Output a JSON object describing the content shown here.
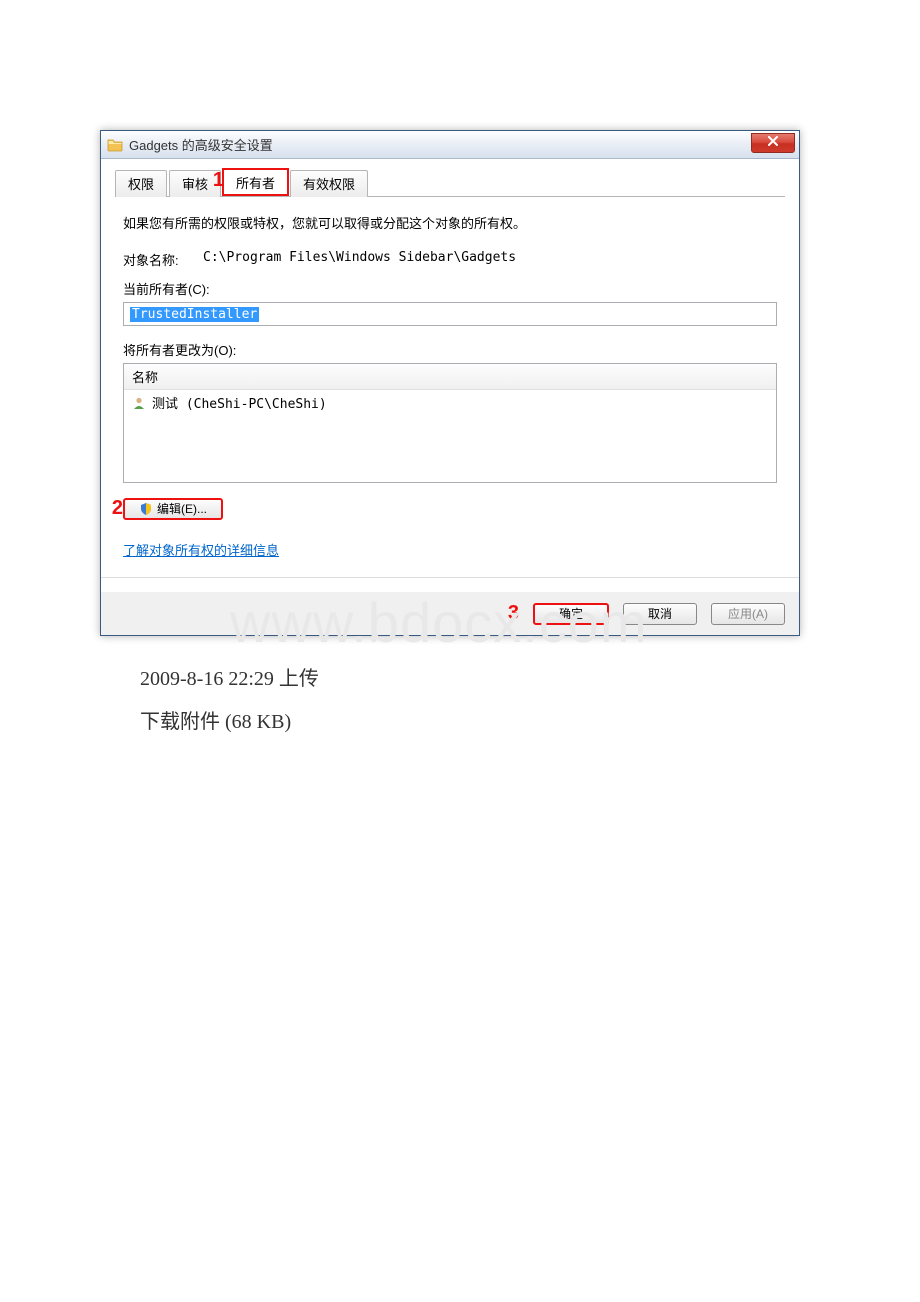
{
  "dialog": {
    "title": "Gadgets 的高级安全设置",
    "close_icon": "×"
  },
  "tabs": {
    "permissions": "权限",
    "auditing": "审核",
    "owner": "所有者",
    "effective": "有效权限"
  },
  "annotations": {
    "one": "1",
    "two": "2",
    "three": "3"
  },
  "content": {
    "intro": "如果您有所需的权限或特权，您就可以取得或分配这个对象的所有权。",
    "object_label": "对象名称:",
    "object_path": "C:\\Program Files\\Windows Sidebar\\Gadgets",
    "current_owner_label": "当前所有者(C):",
    "current_owner_value": "TrustedInstaller",
    "change_owner_label": "将所有者更改为(O):",
    "list_header": "名称",
    "list_item": "测试 (CheShi-PC\\CheShi)",
    "edit_button": "编辑(E)...",
    "learn_link": "了解对象所有权的详细信息"
  },
  "footer": {
    "ok": "确定",
    "cancel": "取消",
    "apply": "应用(A)"
  },
  "page": {
    "upload_caption": "2009-8-16 22:29 上传",
    "download_caption": "下载附件 (68 KB)",
    "watermark": "www.bdocx.com"
  }
}
